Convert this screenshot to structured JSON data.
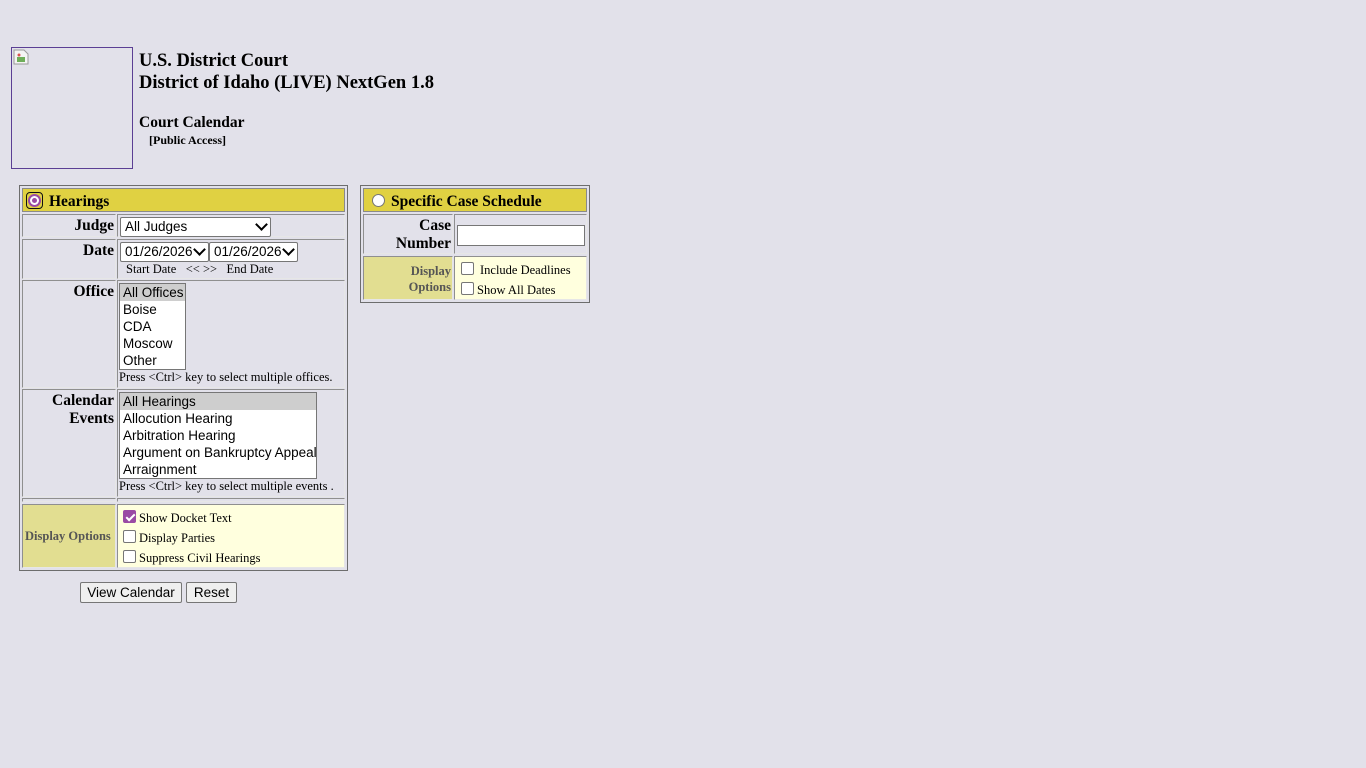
{
  "header": {
    "court_line1": "U.S. District Court",
    "court_line2": "District of Idaho (LIVE) NextGen 1.8",
    "page_title": "Court Calendar",
    "access_label": "[Public Access]"
  },
  "hearings": {
    "radio_label": "Hearings",
    "judge_label": "Judge",
    "judge_value": "All Judges",
    "date_label": "Date",
    "start_date": "01/26/2026",
    "end_date": "01/26/2026",
    "start_caption": "Start Date",
    "prev_arrow": "<<",
    "next_arrow": ">>",
    "end_caption": "End Date",
    "office_label": "Office",
    "offices": [
      "All Offices",
      "Boise",
      "CDA",
      "Moscow",
      "Other"
    ],
    "office_hint": "Press <Ctrl> key to select multiple offices.",
    "events_label_1": "Calendar",
    "events_label_2": "Events",
    "events": [
      "All Hearings",
      "Allocution Hearing",
      "Arbitration Hearing",
      "Argument on Bankruptcy Appeal",
      "Arraignment"
    ],
    "events_hint": "Press <Ctrl> key to select multiple events .",
    "display_options_label": "Display Options",
    "opt_docket": "Show Docket Text",
    "opt_parties": "Display Parties",
    "opt_suppress": "Suppress Civil Hearings"
  },
  "case_schedule": {
    "radio_label": "Specific Case Schedule",
    "case_label_1": "Case",
    "case_label_2": "Number",
    "case_value": "",
    "display_label_1": "Display",
    "display_label_2": "Options",
    "opt_deadlines": "Include Deadlines",
    "opt_all_dates": "Show All Dates"
  },
  "buttons": {
    "view": "View Calendar",
    "reset": "Reset"
  }
}
